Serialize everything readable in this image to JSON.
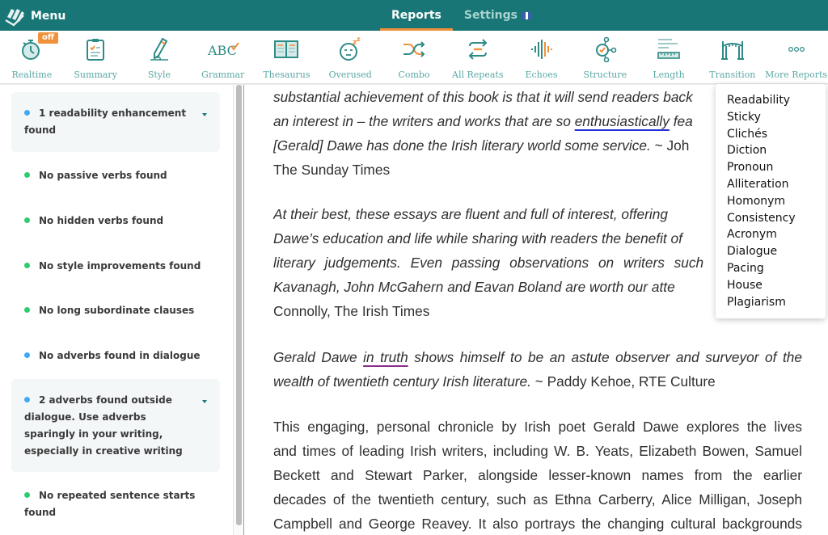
{
  "topbar": {
    "menu_label": "Menu",
    "nav": [
      {
        "label": "Reports",
        "active": true
      },
      {
        "label": "Settings",
        "active": false,
        "flag": "uk-flag-icon"
      }
    ]
  },
  "toolbar": {
    "tools": [
      {
        "label": "Realtime",
        "icon": "stopwatch-icon",
        "badge": "off"
      },
      {
        "label": "Summary",
        "icon": "clipboard-icon"
      },
      {
        "label": "Style",
        "icon": "pencil-icon"
      },
      {
        "label": "Grammar",
        "icon": "abc-check-icon"
      },
      {
        "label": "Thesaurus",
        "icon": "open-book-icon"
      },
      {
        "label": "Overused",
        "icon": "sleepy-face-icon"
      },
      {
        "label": "Combo",
        "icon": "shuffle-icon"
      },
      {
        "label": "All Repeats",
        "icon": "repeat-arrows-icon"
      },
      {
        "label": "Echoes",
        "icon": "sound-wave-icon"
      },
      {
        "label": "Structure",
        "icon": "structure-nodes-icon"
      },
      {
        "label": "Length",
        "icon": "ruler-lines-icon"
      },
      {
        "label": "Transition",
        "icon": "bridge-icon"
      },
      {
        "label": "More Reports",
        "icon": "more-dots-icon"
      }
    ]
  },
  "sidebar": {
    "items": [
      {
        "text": "1 readability enhancement found",
        "status": "blue",
        "expandable": true
      },
      {
        "text": "No passive verbs found",
        "status": "green"
      },
      {
        "text": "No hidden verbs found",
        "status": "green"
      },
      {
        "text": "No style improvements found",
        "status": "green"
      },
      {
        "text": "No long subordinate clauses",
        "status": "green"
      },
      {
        "text": "No adverbs found in dialogue",
        "status": "blue"
      },
      {
        "text": "2 adverbs found outside dialogue. Use adverbs sparingly in your writing, especially in creative writing",
        "status": "blue",
        "expandable": true
      },
      {
        "text": "No repeated sentence starts found",
        "status": "green"
      }
    ]
  },
  "document": {
    "p1": {
      "l1": "substantial achievement of this book is that it will send readers back",
      "l2a": "an interest in – the writers and works that are so ",
      "l2u": "enthusiastically",
      "l2b": " fea",
      "l3a": "[Gerald] Dawe has done the Irish literary world some service.",
      "l3b": " ~ Joh",
      "l4": "The Sunday Times"
    },
    "p2": {
      "l1": "At their best, these essays are fluent and full of interest, offering",
      "l2": "Dawe’s education and life while sharing with readers the benefit of",
      "l3": "literary judgements. Even passing observations on writers such",
      "l4": "Kavanagh, John McGahern and Eavan Boland are worth our atte",
      "l5": "Connolly, The Irish Times"
    },
    "p3": {
      "l1a": "Gerald Dawe ",
      "l1u": "in truth",
      "l1b": " shows himself to be an astute observer and surveyor of the",
      "l2a": "wealth of twentieth century Irish literature.",
      "l2b": " ~ Paddy Kehoe, RTE Culture"
    },
    "p4": {
      "l1": "This engaging, personal chronicle by Irish poet Gerald Dawe explores the lives",
      "l2": "and times of leading Irish writers, including W. B. Yeats, Elizabeth Bowen, Samuel",
      "l3": "Beckett and Stewart Parker, alongside lesser-known names from the earlier",
      "l4": "decades of the twentieth century, such as Ethna Carberry, Alice Milligan, Joseph",
      "l5": "Campbell and George Reavey. It also portrays the changing cultural backgrounds"
    }
  },
  "more_reports_menu": {
    "items": [
      "Readability",
      "Sticky",
      "Clichés",
      "Diction",
      "Pronoun",
      "Alliteration",
      "Homonym",
      "Consistency",
      "Acronym",
      "Dialogue",
      "Pacing",
      "House",
      "Plagiarism"
    ]
  },
  "colors": {
    "brand_teal": "#187676",
    "accent_orange": "#f0913c",
    "status_blue": "#3fa9f5",
    "status_green": "#2ecc71",
    "underline_adverb": "#2431d6",
    "underline_readability": "#8b2f8b"
  }
}
